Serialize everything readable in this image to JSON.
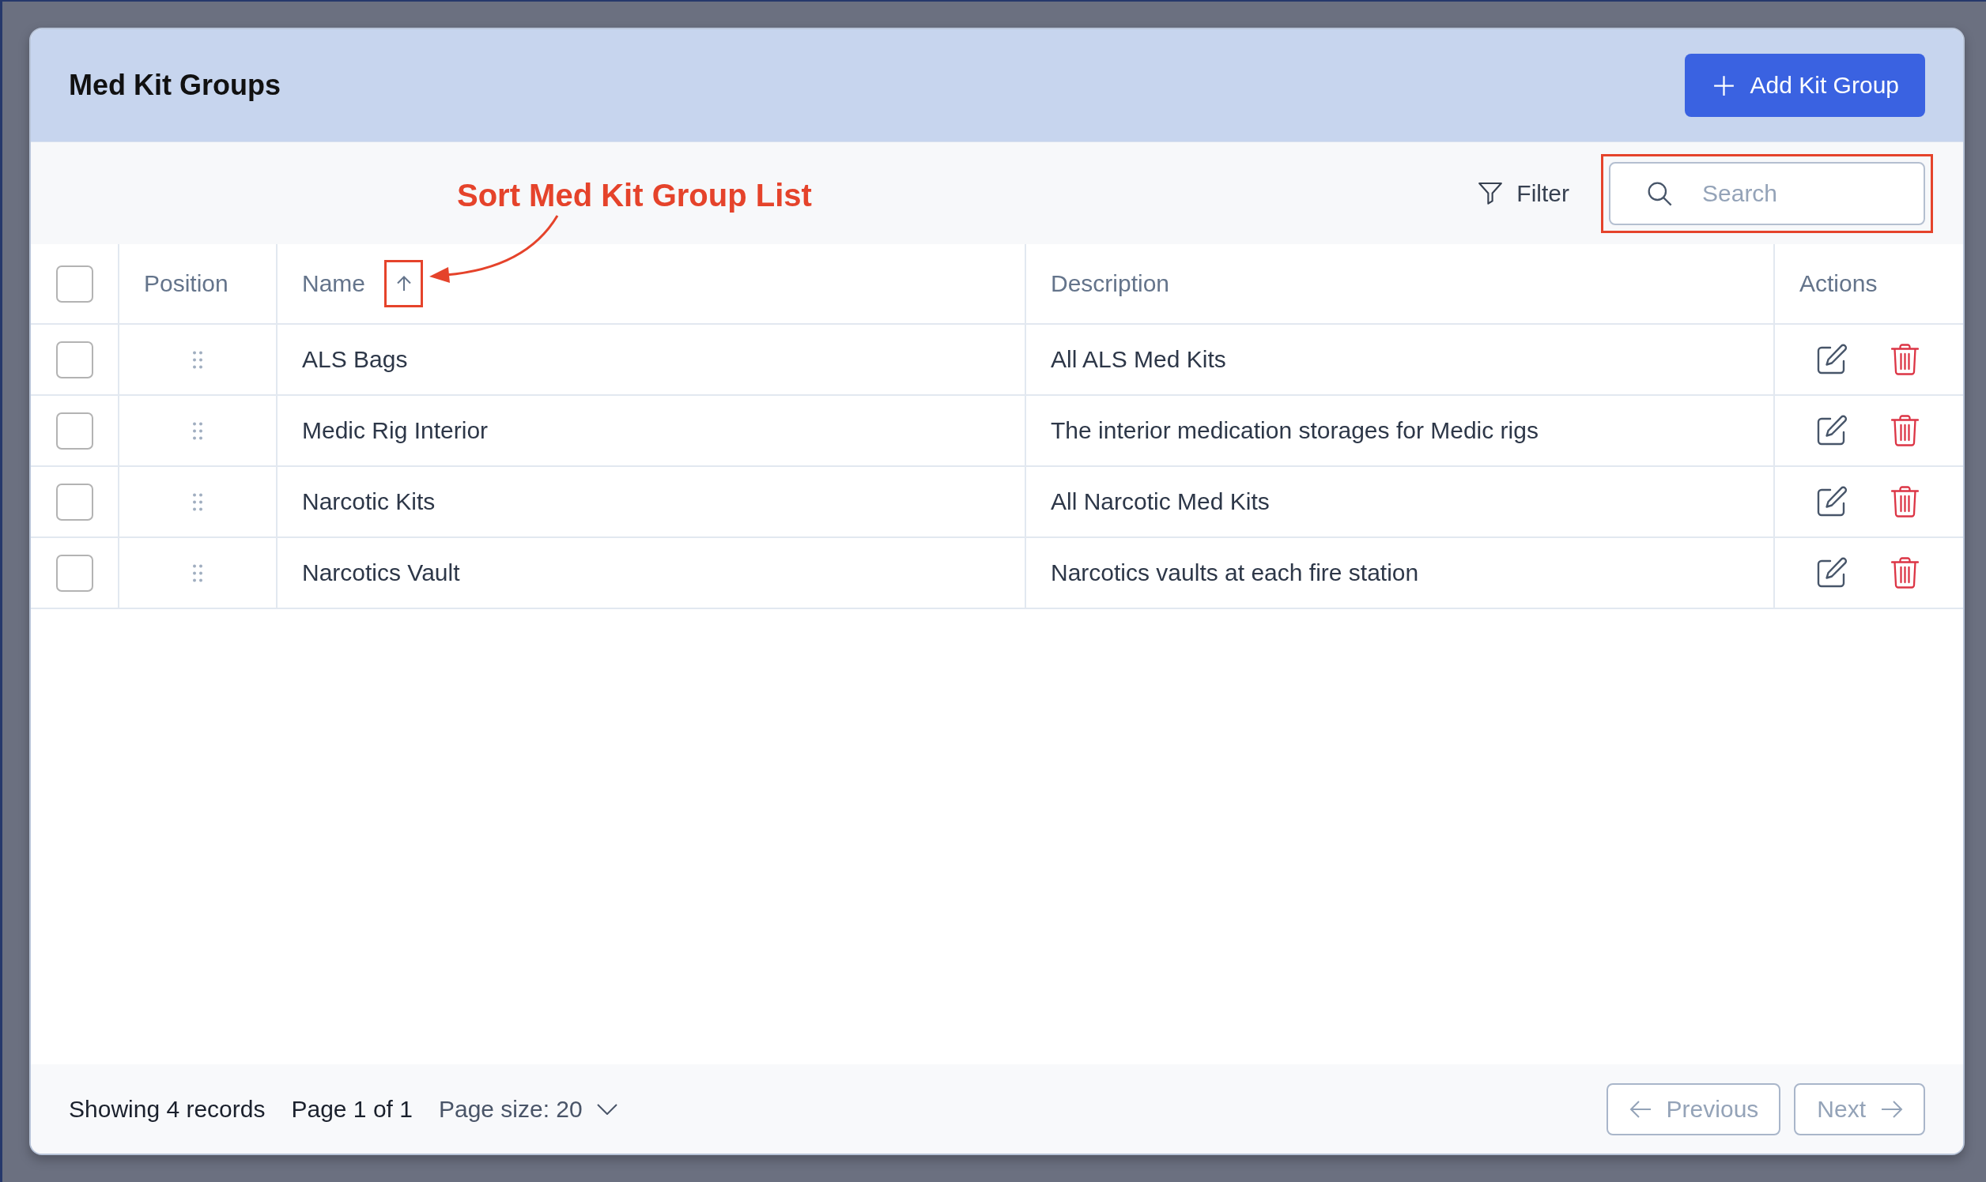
{
  "header": {
    "title": "Med Kit Groups",
    "add_button": {
      "label": "Add Kit Group"
    }
  },
  "annotation": {
    "text": "Sort Med Kit Group List"
  },
  "toolbar": {
    "filter": {
      "label": "Filter"
    },
    "search": {
      "placeholder": "Search",
      "highlighted": true
    }
  },
  "table": {
    "select_all": {
      "checked": false
    },
    "columns": [
      {
        "label": "Position"
      },
      {
        "label": "Name",
        "sort": {
          "ascending": true,
          "highlighted": true
        }
      },
      {
        "label": "Description"
      },
      {
        "label": "Actions"
      }
    ],
    "rows": [
      {
        "checked": false,
        "name": "ALS Bags",
        "description": "All ALS Med Kits"
      },
      {
        "checked": false,
        "name": "Medic Rig Interior",
        "description": "The interior medication storages for Medic rigs"
      },
      {
        "checked": false,
        "name": "Narcotic Kits",
        "description": "All Narcotic Med Kits"
      },
      {
        "checked": false,
        "name": "Narcotics Vault",
        "description": "Narcotics vaults at each fire station"
      }
    ]
  },
  "footer": {
    "summary": "Showing 4 records",
    "page": "Page 1 of 1",
    "page_size": "Page size: 20",
    "previous": {
      "label": "Previous",
      "disabled": true
    },
    "next": {
      "label": "Next",
      "disabled": true
    }
  }
}
